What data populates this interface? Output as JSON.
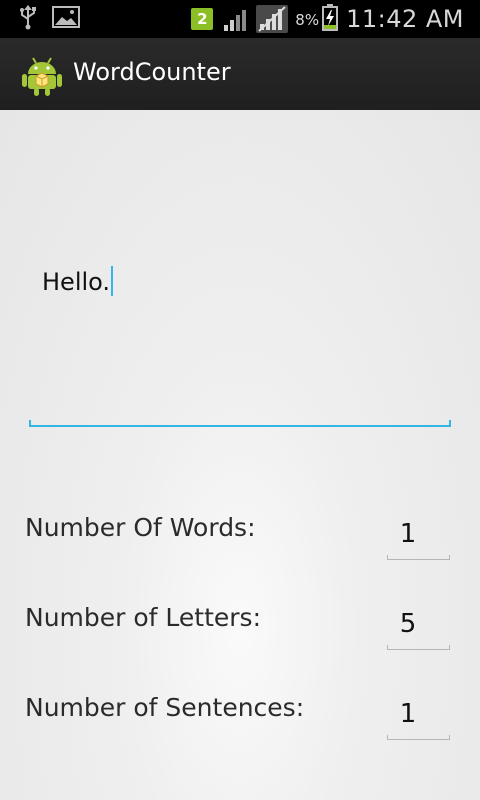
{
  "status_bar": {
    "sim_slot": "2",
    "battery_percent": "8%",
    "time": "11:42 AM",
    "icons": [
      "usb-icon",
      "image-icon",
      "sim-icon",
      "signal-icon",
      "signal-icon",
      "battery-charging-icon"
    ]
  },
  "action_bar": {
    "title": "WordCounter",
    "icon": "android-icon"
  },
  "editor": {
    "text": "Hello."
  },
  "stats": [
    {
      "label": "Number Of Words:",
      "value": "1"
    },
    {
      "label": "Number of Letters:",
      "value": "5"
    },
    {
      "label": "Number of Sentences:",
      "value": "1"
    }
  ],
  "colors": {
    "accent": "#33b5e5",
    "action_bar": "#262626",
    "status_bar": "#000000",
    "sim_badge": "#8cbf26"
  }
}
